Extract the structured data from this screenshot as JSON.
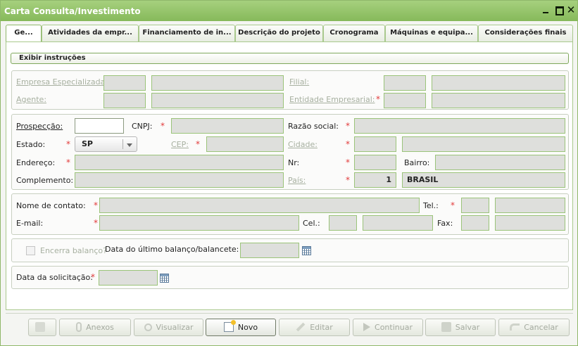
{
  "window": {
    "title": "Carta Consulta/Investimento"
  },
  "tabs": [
    {
      "label": "Ge..."
    },
    {
      "label": "Atividades da empr..."
    },
    {
      "label": "Financiamento de in..."
    },
    {
      "label": "Descrição do projeto"
    },
    {
      "label": "Cronograma"
    },
    {
      "label": "Máquinas e equipa..."
    },
    {
      "label": "Considerações finais"
    }
  ],
  "instructions_button": "Exibir instruções",
  "group1": {
    "empresa_label": "Empresa Especializada:",
    "filial_label": "Filial:",
    "agente_label": "Agente:",
    "entidade_label": "Entidade Empresarial:"
  },
  "group2": {
    "prospeccao_label": "Prospecção:",
    "cnpj_label": "CNPJ:",
    "razao_label": "Razão social:",
    "estado_label": "Estado:",
    "estado_value": "SP",
    "cep_label": "CEP:",
    "cidade_label": "Cidade:",
    "endereco_label": "Endereço:",
    "nr_label": "Nr:",
    "bairro_label": "Bairro:",
    "complemento_label": "Complemento:",
    "pais_label": "País:",
    "pais_code": "1",
    "pais_name": "BRASIL"
  },
  "group3": {
    "contato_label": "Nome de contato:",
    "tel_label": "Tel.:",
    "email_label": "E-mail:",
    "cel_label": "Cel.:",
    "fax_label": "Fax:"
  },
  "group4": {
    "encerra_label": "Encerra balanço?",
    "data_balanco_label": "Data do último balanço/balancete:"
  },
  "group5": {
    "data_solicitacao_label": "Data da solicitação:"
  },
  "required_mark": "*",
  "footer": {
    "anexos": "Anexos",
    "visualizar": "Visualizar",
    "novo": "Novo",
    "editar": "Editar",
    "continuar": "Continuar",
    "salvar": "Salvar",
    "cancelar": "Cancelar"
  }
}
